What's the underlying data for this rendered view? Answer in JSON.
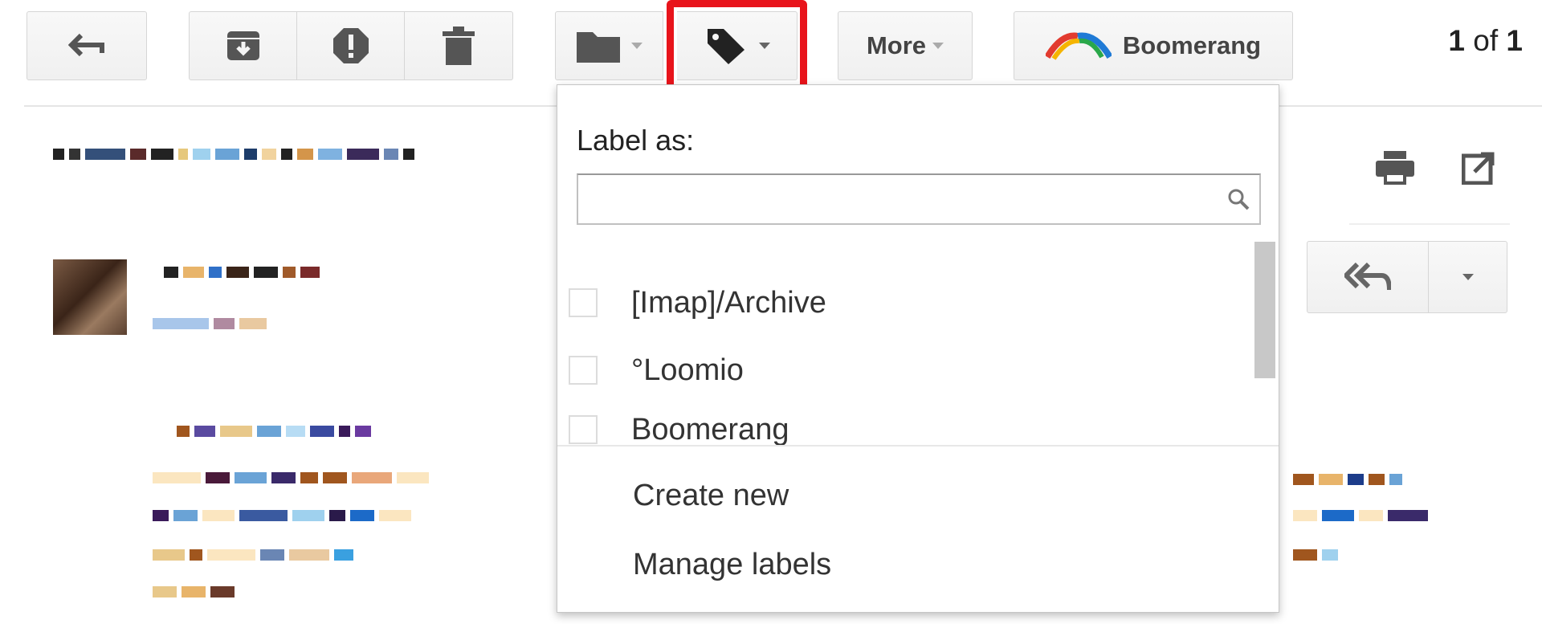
{
  "toolbar": {
    "back_icon": "back-arrow-icon",
    "archive_icon": "archive-icon",
    "spam_icon": "report-spam-icon",
    "delete_icon": "trash-icon",
    "move_icon": "folder-icon",
    "labels_icon": "label-tag-icon",
    "more_label": "More",
    "boomerang_label": "Boomerang",
    "highlight_color": "#e8141b"
  },
  "pager": {
    "current": "1",
    "separator": "of",
    "total": "1"
  },
  "label_menu": {
    "title": "Label as:",
    "search_placeholder": "",
    "search_value": "",
    "labels": [
      {
        "name": "[Imap]/Archive",
        "checked": false
      },
      {
        "name": "°Loomio",
        "checked": false
      },
      {
        "name": "Boomerang",
        "checked": false
      }
    ],
    "actions": {
      "create_new": "Create new",
      "manage_labels": "Manage labels"
    }
  },
  "message": {
    "print_icon": "print-icon",
    "new_window_icon": "open-in-new-window-icon",
    "reply_all_icon": "reply-all-icon",
    "more_icon": "chevron-down-icon"
  }
}
